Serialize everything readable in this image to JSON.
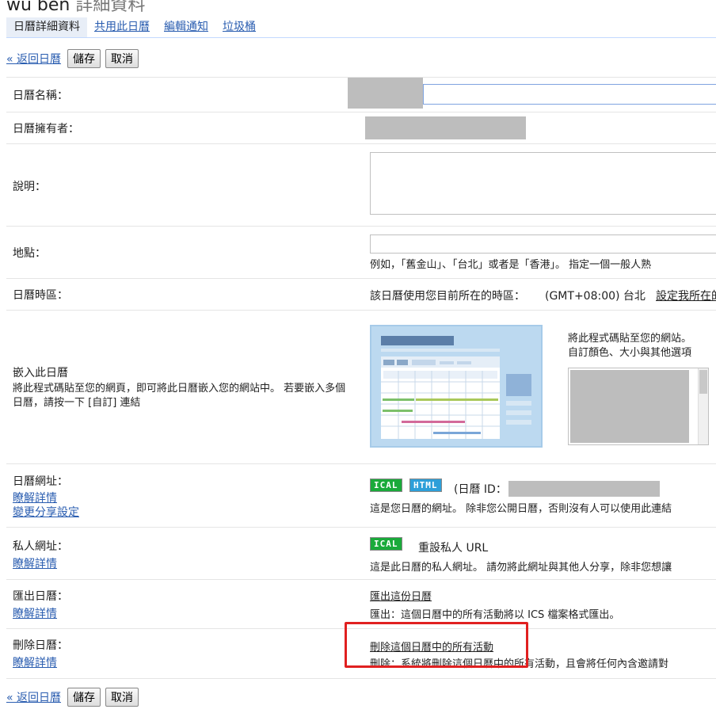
{
  "header": {
    "title": "wu ben",
    "subtitle": "詳細資料"
  },
  "tabs": [
    {
      "label": "日曆詳細資料"
    },
    {
      "label": "共用此日曆"
    },
    {
      "label": "編輯通知"
    },
    {
      "label": "垃圾桶"
    }
  ],
  "actions": {
    "back": "« 返回日曆",
    "save": "儲存",
    "cancel": "取消"
  },
  "rows": {
    "name": {
      "label": "日曆名稱："
    },
    "owner": {
      "label": "日曆擁有者："
    },
    "description": {
      "label": "說明："
    },
    "location": {
      "label": "地點：",
      "hint": "例如，「舊金山」、「台北」或者是「香港」。 指定一個一般人熟"
    },
    "timezone": {
      "label": "日曆時區：",
      "text": "該日曆使用您目前所在的時區：",
      "zone": "(GMT+08:00) 台北",
      "link": "設定我所在的"
    },
    "embed": {
      "label": "嵌入此日曆",
      "desc": "將此程式碼貼至您的網頁，即可將此日曆嵌入您的網站中。 若要嵌入多個日曆，請按一下 [自訂] 連結",
      "paste_text": "將此程式碼貼至您的網站。",
      "customize_link": "自訂顏色、大小與其他選項"
    },
    "calendar_url": {
      "label": "日曆網址：",
      "learn_more": "瞭解詳情",
      "change_sharing": "變更分享設定",
      "ical": "ICAL",
      "html": "HTML",
      "id_label": "(日曆 ID：",
      "note": "這是您日曆的網址。 除非您公開日曆，否則沒有人可以使用此連結"
    },
    "private_url": {
      "label": "私人網址：",
      "learn_more": "瞭解詳情",
      "ical": "ICAL",
      "reset_link": "重設私人 URL",
      "note": "這是此日曆的私人網址。 請勿將此網址與其他人分享，除非您想讓"
    },
    "export": {
      "label": "匯出日曆：",
      "learn_more": "瞭解詳情",
      "link": "匯出這份日曆",
      "note": "匯出：這個日曆中的所有活動將以 ICS 檔案格式匯出。"
    },
    "delete": {
      "label": "刪除日曆：",
      "learn_more": "瞭解詳情",
      "link": "刪除這個日曆中的所有活動",
      "note": "刪除：系統將刪除這個日曆中的所有活動，且會將任何內含邀請對"
    }
  },
  "colors": {
    "link": "#2a5db0",
    "highlight": "#e02020",
    "tab_active_bg": "#e8eef7"
  }
}
